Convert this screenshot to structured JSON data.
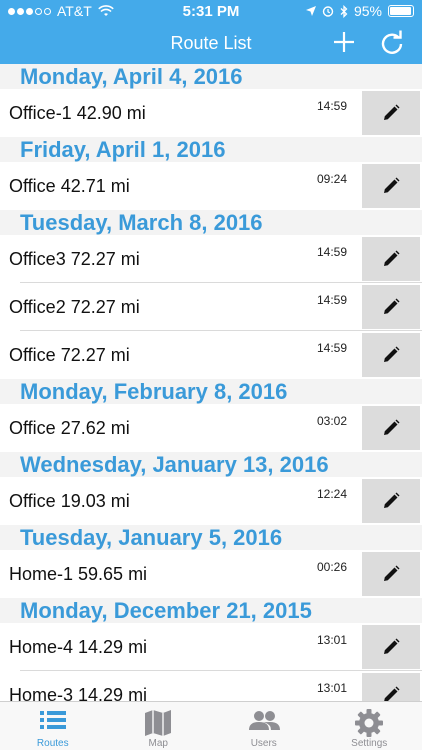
{
  "status_bar": {
    "carrier": "AT&T",
    "time": "5:31 PM",
    "battery": "95%"
  },
  "header": {
    "title": "Route List",
    "add_icon": "plus-icon",
    "refresh_icon": "refresh-icon"
  },
  "sections": [
    {
      "date": "Monday, April 4, 2016",
      "routes": [
        {
          "name": "Office-1 42.90 mi",
          "time": "14:59"
        }
      ]
    },
    {
      "date": "Friday, April 1, 2016",
      "routes": [
        {
          "name": "Office 42.71 mi",
          "time": "09:24"
        }
      ]
    },
    {
      "date": "Tuesday, March 8, 2016",
      "routes": [
        {
          "name": "Office3 72.27 mi",
          "time": "14:59"
        },
        {
          "name": "Office2 72.27 mi",
          "time": "14:59"
        },
        {
          "name": "Office 72.27 mi",
          "time": "14:59"
        }
      ]
    },
    {
      "date": "Monday, February 8, 2016",
      "routes": [
        {
          "name": "Office 27.62 mi",
          "time": "03:02"
        }
      ]
    },
    {
      "date": "Wednesday, January 13, 2016",
      "routes": [
        {
          "name": "Office 19.03 mi",
          "time": "12:24"
        }
      ]
    },
    {
      "date": "Tuesday, January 5, 2016",
      "routes": [
        {
          "name": "Home-1 59.65 mi",
          "time": "00:26"
        }
      ]
    },
    {
      "date": "Monday, December 21, 2015",
      "routes": [
        {
          "name": "Home-4 14.29 mi",
          "time": "13:01"
        },
        {
          "name": "Home-3 14.29 mi",
          "time": "13:01"
        }
      ]
    }
  ],
  "tabs": [
    {
      "label": "Routes",
      "icon": "list-icon",
      "active": true
    },
    {
      "label": "Map",
      "icon": "map-icon",
      "active": false
    },
    {
      "label": "Users",
      "icon": "users-icon",
      "active": false
    },
    {
      "label": "Settings",
      "icon": "gear-icon",
      "active": false
    }
  ],
  "colors": {
    "nav_bar": "#44aaea",
    "section_text": "#3a9ad9",
    "section_bg": "#f3f3f3",
    "edit_button": "#dcdcdc",
    "tab_active": "#3a9ad9",
    "tab_inactive": "#8e8e93"
  }
}
